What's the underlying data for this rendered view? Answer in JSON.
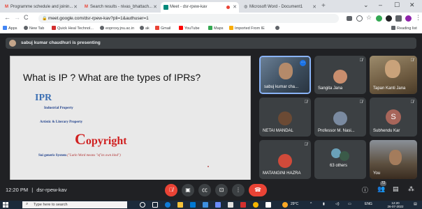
{
  "browser": {
    "tabs": [
      {
        "label": "Programme schedule and joinin...",
        "icon": "gmail-icon"
      },
      {
        "label": "Search results - nivas_bhattach...",
        "icon": "gmail-icon"
      },
      {
        "label": "Meet - dsr-rpew-kav",
        "icon": "meet-icon"
      },
      {
        "label": "Microsoft Word - Document1",
        "icon": "globe-icon"
      }
    ],
    "new_tab": "+",
    "url": "meet.google.com/dsr-rpew-kav?pli=1&authuser=1",
    "bookmarks": [
      "Apps",
      "New Tab",
      "Quick Heal Technol...",
      "eoproxy.jnu.ac.in",
      "ak",
      "Gmail",
      "YouTube",
      "Maps",
      "Imported From IE"
    ],
    "reading_list": "Reading list"
  },
  "meet": {
    "presenting_banner": "sabuj kumar chaudhuri is presenting",
    "slide": {
      "title": "What is IP ? What are the types of IPRs?",
      "ipr": "IPR",
      "industrial": "Industrial Property",
      "artistic": "Artistic & Literary Property",
      "copyright_first": "C",
      "copyright_rest": "opyright",
      "sui_generis": "Sui generis  System",
      "sui_note": "(\"Latin Word means \"of its own kind\")"
    },
    "participants": [
      {
        "name": "sabuj kumar cha...",
        "kind": "video",
        "active": true
      },
      {
        "name": "Sangita Jana",
        "kind": "avatar",
        "color": "#c98e6e"
      },
      {
        "name": "Tapan Kanti Jana",
        "kind": "video"
      },
      {
        "name": "NETAI MANDAL",
        "kind": "avatar",
        "color": "#6b4a34"
      },
      {
        "name": "Professor M. Nasi...",
        "kind": "avatar",
        "color": "#7a8aa0"
      },
      {
        "name": "Subhendu Kar",
        "kind": "letter",
        "letter": "S"
      },
      {
        "name": "MATANGINI HAZRA",
        "kind": "avatar",
        "color": "#d04a3a"
      },
      {
        "name": "63 others",
        "kind": "group"
      },
      {
        "name": "You",
        "kind": "video"
      }
    ],
    "time": "12:20 PM",
    "separator": "|",
    "meeting_code": "dsr-rpew-kav",
    "people_count": "72"
  },
  "taskbar": {
    "search_placeholder": "Type here to search",
    "temperature": "29°C",
    "language": "ENG",
    "clock_time": "12:20",
    "clock_date": "26-07-2022"
  }
}
